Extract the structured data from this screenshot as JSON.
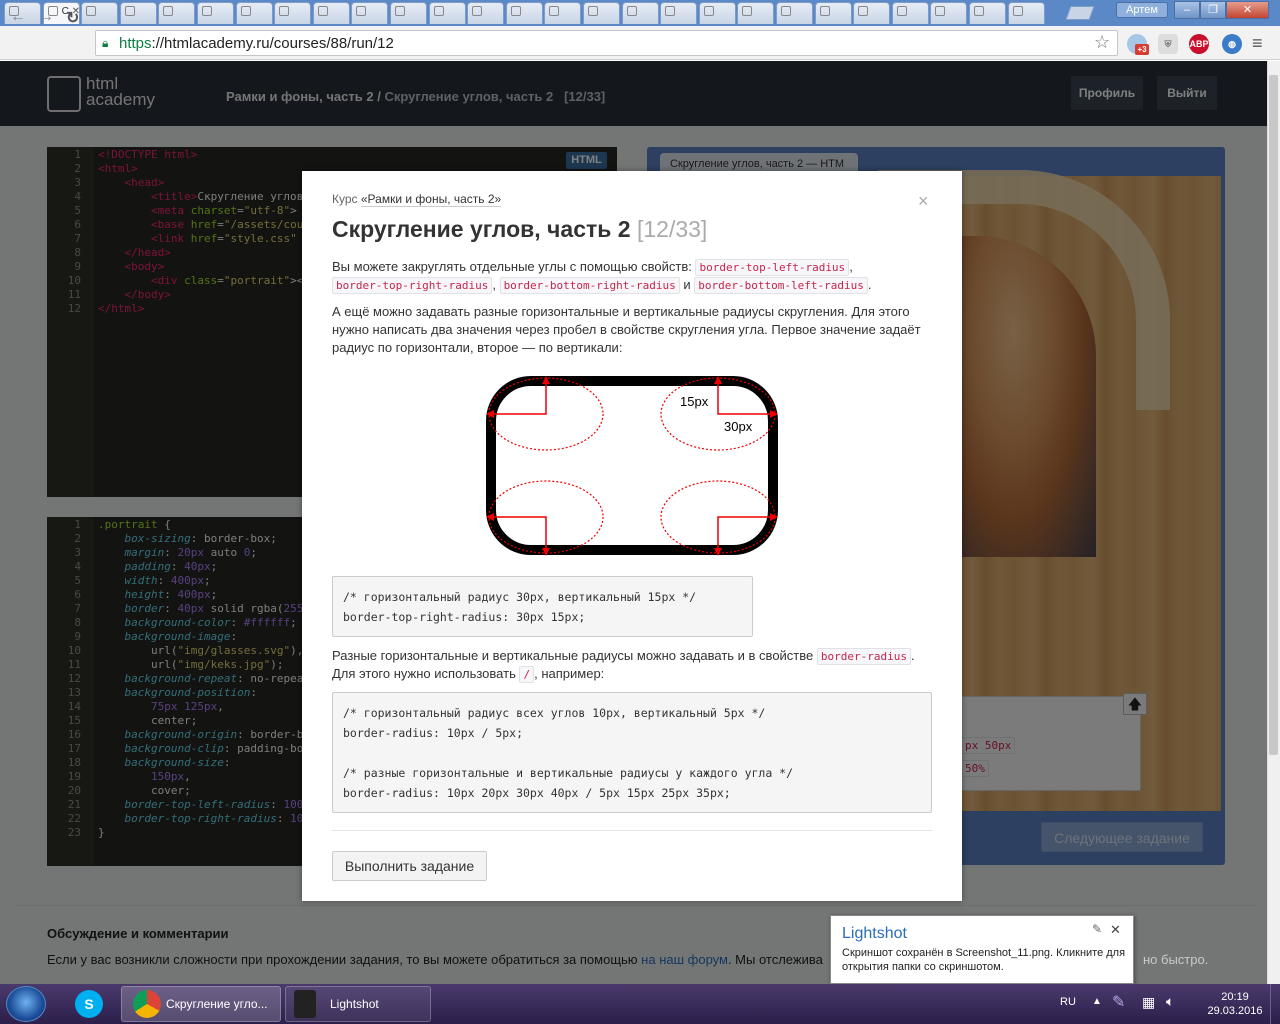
{
  "browser": {
    "tabs": [
      "",
      "С",
      "",
      "",
      "",
      "",
      "",
      "",
      "",
      "",
      "",
      "",
      "",
      "",
      "",
      "",
      "",
      "",
      "",
      "",
      "",
      "",
      "",
      "",
      "",
      "",
      ""
    ],
    "active_tab_label": "С",
    "window_user": "Артем",
    "url_scheme": "https",
    "url_rest": "://htmlacademy.ru/courses/88/run/12",
    "ext_badge": "+3",
    "ext_abp": "ABP"
  },
  "site": {
    "logo_line1": "html",
    "logo_line2": "academy",
    "crumb_course": "Рамки и фоны, часть 2 /",
    "crumb_task": "Скругление углов, часть 2",
    "crumb_progress": "[12/33]",
    "profile_btn": "Профиль",
    "logout_btn": "Выйти"
  },
  "html_editor": {
    "badge": "HTML",
    "line_numbers": "1\n2\n3\n4\n5\n6\n7\n8\n9\n10\n11\n12"
  },
  "css_editor": {
    "line_numbers": "1\n2\n3\n4\n5\n6\n7\n8\n9\n10\n11\n12\n13\n14\n15\n16\n17\n18\n19\n20\n21\n22\n23"
  },
  "preview": {
    "tab_label": "Скругление углов, часть 2 — HTM",
    "result_line1": "px 50px",
    "result_line2": "50%",
    "next_btn": "Следующее задание"
  },
  "modal": {
    "course_prefix": "Курс ",
    "course_link": "«Рамки и фоны, часть 2»",
    "title": "Скругление углов, часть 2",
    "title_progress": "[12/33]",
    "p1_text": "Вы можете закруглять отдельные углы с помощью свойств:",
    "kw_tl": "border-top-left-radius",
    "kw_tr": "border-top-right-radius",
    "kw_br": "border-bottom-right-radius",
    "kw_bl": "border-bottom-left-radius",
    "and_word": "и",
    "p2": "А ещё можно задавать разные горизонтальные и вертикальные радиусы скругления. Для этого нужно написать два значения через пробел в свойстве скругления угла. Первое значение задаёт радиус по горизонтали, второе — по вертикали:",
    "diagram_label_v": "15px",
    "diagram_label_h": "30px",
    "code1": "/* горизонтальный радиус 30px, вертикальный 15px */\nborder-top-right-radius: 30px 15px;",
    "p3_a": "Разные горизонтальные и вертикальные радиусы можно задавать и в свойстве",
    "kw_br_radius": "border-radius",
    "p3_b": "Для этого нужно использовать",
    "kw_slash": "/",
    "p3_c": ", например:",
    "code2": "/* горизонтальный радиус всех углов 10px, вертикальный 5px */\nborder-radius: 10px / 5px;\n\n/* разные горизонтальные и вертикальные радиусы у каждого угла */\nborder-radius: 10px 20px 30px 40px / 5px 15px 25px 35px;",
    "run_btn": "Выполнить задание",
    "close": "×"
  },
  "discussion": {
    "title": "Обсуждение и комментарии",
    "text_a": "Если у вас возникли сложности при прохождении задания, то вы можете обратиться за помощью",
    "link": "на наш форум",
    "text_b": ". Мы отслежива",
    "text_end": "но быстро."
  },
  "lightshot": {
    "title": "Lightshot",
    "message": "Скриншот сохранён в Screenshot_11.png. Кликните для открытия папки со скриншотом.",
    "close": "✕"
  },
  "taskbar": {
    "app_chrome": "Скругление угло...",
    "app_lightshot": "Lightshot",
    "lang": "RU",
    "time": "20:19",
    "date": "29.03.2016"
  },
  "colors": {
    "accent": "#5b80c3",
    "header": "#283038",
    "keyword": "#c7254e"
  }
}
